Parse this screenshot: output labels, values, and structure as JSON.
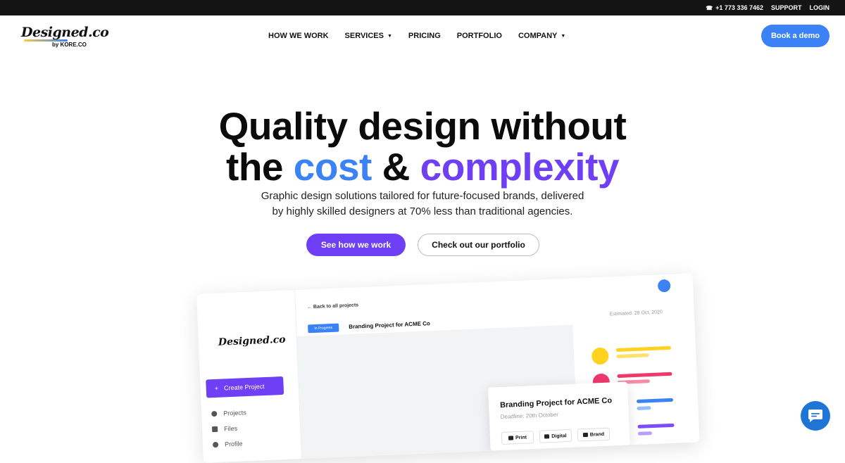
{
  "topbar": {
    "phone": "+1 773 336 7462",
    "support": "SUPPORT",
    "login": "LOGIN"
  },
  "logo": {
    "text": "Designed.co",
    "by": "by KORE.CO"
  },
  "nav": {
    "items": [
      {
        "label": "HOW WE WORK",
        "dropdown": false
      },
      {
        "label": "SERVICES",
        "dropdown": true
      },
      {
        "label": "PRICING",
        "dropdown": false
      },
      {
        "label": "PORTFOLIO",
        "dropdown": false
      },
      {
        "label": "COMPANY",
        "dropdown": true
      }
    ],
    "book_demo": "Book a demo"
  },
  "hero": {
    "title_line1": "Quality design without",
    "title_the": "the ",
    "title_cost": "cost",
    "title_amp": " & ",
    "title_complexity": "complexity",
    "subtitle_line1": "Graphic design solutions tailored for future-focused brands, delivered",
    "subtitle_line2": "by highly skilled designers at 70% less than traditional agencies.",
    "cta_primary": "See how we work",
    "cta_secondary": "Check out our portfolio"
  },
  "mockup": {
    "logo": "Designed.co",
    "create_project": "Create Project",
    "nav": [
      "Projects",
      "Files",
      "Profile"
    ],
    "back_link": "Back to all projects",
    "status": "In Progress",
    "project_title": "Branding Project for ACME Co",
    "estimated": "Estimated: 28 Oct, 2020",
    "card": {
      "title": "Branding Project for ACME Co",
      "deadline": "Deadline: 20th October",
      "chips": [
        "Print",
        "Digital",
        "Brand"
      ]
    }
  },
  "colors": {
    "blue": "#3b82f6",
    "purple": "#6f3ff5",
    "yellow": "#ffd21f",
    "pink": "#f0386b",
    "chat": "#1f75d6"
  },
  "chat": {
    "icon": "chat-bubble-icon"
  }
}
